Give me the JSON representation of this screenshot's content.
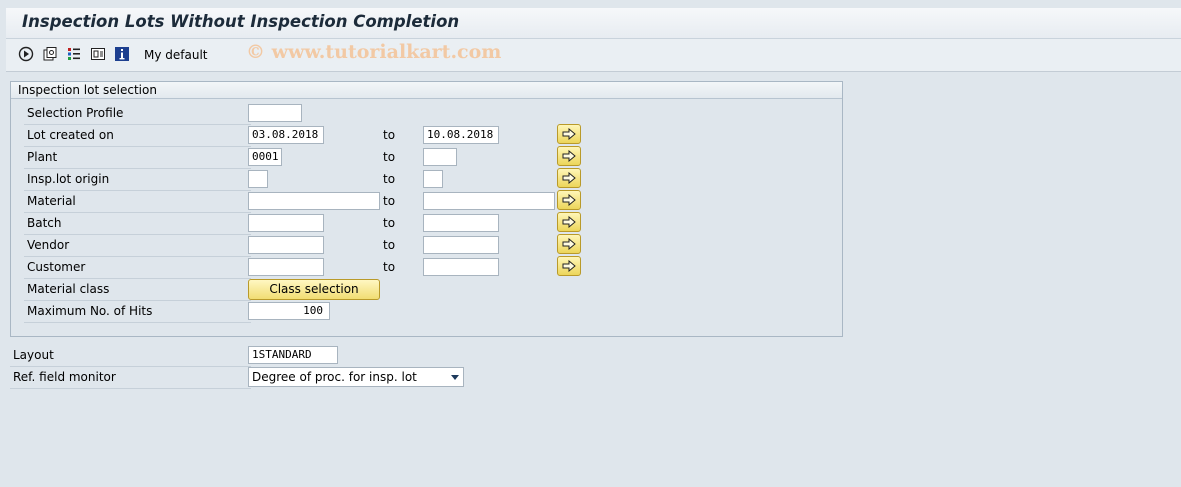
{
  "window": {
    "title": "Inspection Lots Without Inspection Completion"
  },
  "watermark": "© www.tutorialkart.com",
  "toolbar": {
    "icons": [
      "execute-icon",
      "get-variant-icon",
      "dynamic-selections-icon",
      "selection-options-icon",
      "info-icon"
    ],
    "my_default_label": "My default"
  },
  "selection": {
    "group_title": "Inspection lot selection",
    "to_label": "to",
    "rows": [
      {
        "label": "Selection Profile",
        "from": "",
        "to": null
      },
      {
        "label": "Lot created on",
        "from": "03.08.2018",
        "to": "10.08.2018"
      },
      {
        "label": "Plant",
        "from": "0001",
        "to": ""
      },
      {
        "label": "Insp.lot origin",
        "from": "",
        "to": ""
      },
      {
        "label": "Material",
        "from": "",
        "to": ""
      },
      {
        "label": "Batch",
        "from": "",
        "to": ""
      },
      {
        "label": "Vendor",
        "from": "",
        "to": ""
      },
      {
        "label": "Customer",
        "from": "",
        "to": ""
      }
    ],
    "material_class": {
      "label": "Material class",
      "button_label": "Class selection"
    },
    "max_hits": {
      "label": "Maximum No. of Hits",
      "value": "100"
    }
  },
  "layout": {
    "label": "Layout",
    "value": "1STANDARD"
  },
  "ref_field_monitor": {
    "label": "Ref. field monitor",
    "value": "Degree of proc. for insp. lot"
  },
  "colors": {
    "button_yellow": "#ecd55a",
    "background": "#dfe6ec",
    "title_text": "#1c2b3a"
  }
}
